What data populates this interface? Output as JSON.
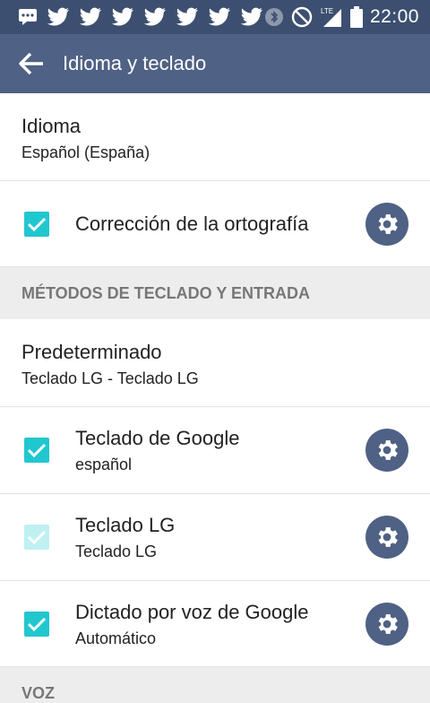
{
  "status_bar": {
    "icons": [
      "message-icon",
      "twitter-icon",
      "twitter-icon",
      "twitter-icon",
      "twitter-icon",
      "twitter-icon",
      "twitter-icon",
      "twitter-icon",
      "bluetooth-icon",
      "do-not-disturb-icon",
      "lte-signal-icon",
      "battery-icon"
    ],
    "lte_label": "LTE",
    "time": "22:00"
  },
  "app_bar": {
    "title": "Idioma y teclado"
  },
  "rows": {
    "idioma": {
      "title": "Idioma",
      "subtitle": "Español (España)"
    },
    "correccion": {
      "title": "Corrección de la ortografía",
      "checked": true
    },
    "section_teclado": "MÉTODOS DE TECLADO Y ENTRADA",
    "predeterminado": {
      "title": "Predeterminado",
      "subtitle": "Teclado LG - Teclado LG"
    },
    "google": {
      "title": "Teclado de Google",
      "subtitle": "español",
      "checked": true
    },
    "lg": {
      "title": "Teclado LG",
      "subtitle": "Teclado LG",
      "checked": true,
      "disabled": true
    },
    "dictado": {
      "title": "Dictado por voz de Google",
      "subtitle": "Automático",
      "checked": true
    },
    "section_voz": "VOZ"
  },
  "colors": {
    "status_bar": "#3d4f70",
    "app_bar": "#4f6184",
    "accent": "#21c7cf",
    "section_bg": "#ededed"
  }
}
